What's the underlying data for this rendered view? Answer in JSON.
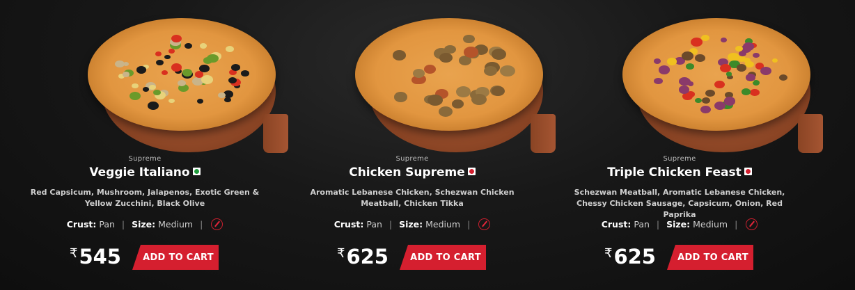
{
  "products": [
    {
      "category": "Supreme",
      "name": "Veggie Italiano",
      "diet": "veg",
      "description": "Red Capsicum, Mushroom, Jalapenos, Exotic Green & Yellow Zucchini, Black Olive",
      "crust_label": "Crust:",
      "crust_value": "Pan",
      "size_label": "Size:",
      "size_value": "Medium",
      "currency": "₹",
      "price": "545",
      "cart_label": "ADD TO CART"
    },
    {
      "category": "Supreme",
      "name": "Chicken Supreme",
      "diet": "nonveg",
      "description": "Aromatic Lebanese Chicken, Schezwan Chicken Meatball, Chicken Tikka",
      "crust_label": "Crust:",
      "crust_value": "Pan",
      "size_label": "Size:",
      "size_value": "Medium",
      "currency": "₹",
      "price": "625",
      "cart_label": "ADD TO CART"
    },
    {
      "category": "Supreme",
      "name": "Triple Chicken Feast",
      "diet": "nonveg",
      "description": "Schezwan Meatball, Aromatic Lebanese Chicken, Chessy Chicken Sausage, Capsicum, Onion, Red Paprika",
      "crust_label": "Crust:",
      "crust_value": "Pan",
      "size_label": "Size:",
      "size_value": "Medium",
      "currency": "₹",
      "price": "625",
      "cart_label": "ADD TO CART"
    }
  ],
  "colors": {
    "background": "#141414",
    "accent_red": "#d51f2f",
    "veg_green": "#1f9b3c",
    "nonveg_red": "#d32030"
  },
  "icons": {
    "edit": "pencil-edit-icon",
    "veg": "veg-indicator-icon",
    "nonveg": "nonveg-indicator-icon"
  }
}
